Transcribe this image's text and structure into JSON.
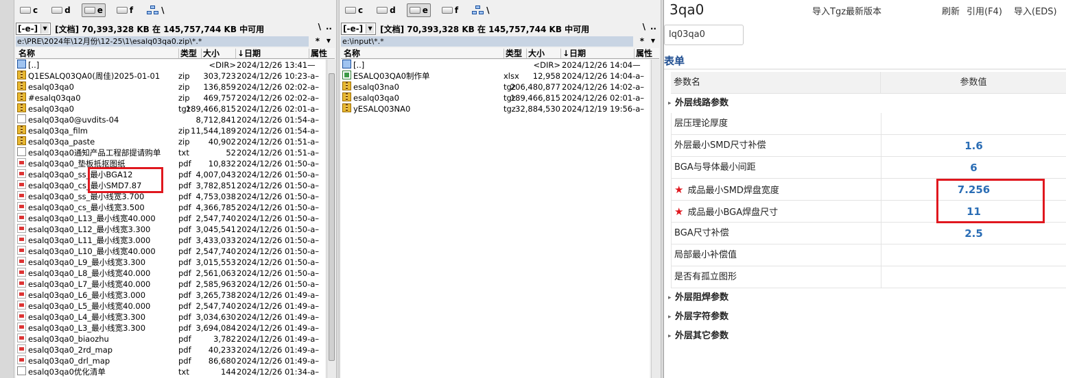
{
  "total_commander": {
    "drives": [
      "c",
      "d",
      "e",
      "f",
      "\\"
    ],
    "active_drive": "e",
    "left": {
      "drive_select": "[-e-]",
      "info": "[文档]  70,393,328 KB 在 145,757,744 KB 中可用",
      "back_btn": "\\",
      "up_btn": "..",
      "path": "e:\\PRE\\2024年\\12月份\\12-25\\1\\esalq03qa0.zip\\*.*",
      "filter_star": "*",
      "columns": [
        "名称",
        "类型",
        "大小",
        "↓日期",
        "属性"
      ],
      "files": [
        {
          "icon": "up",
          "name": "[..]",
          "type": "",
          "size": "<DIR>",
          "date": "2024/12/26 13:41—"
        },
        {
          "icon": "zip",
          "name": "Q1ESALQ03QA0(周佳)2025-01-01",
          "type": "zip",
          "size": "303,723",
          "date": "2024/12/26 10:23-a–"
        },
        {
          "icon": "zip",
          "name": "esalq03qa0",
          "type": "zip",
          "size": "136,859",
          "date": "2024/12/26 02:02-a–"
        },
        {
          "icon": "zip",
          "name": "#esalq03qa0",
          "type": "zip",
          "size": "469,757",
          "date": "2024/12/26 02:02-a–"
        },
        {
          "icon": "zip",
          "name": "esalq03qa0",
          "type": "tgz",
          "size": "189,466,815",
          "date": "2024/12/26 02:01-a–"
        },
        {
          "icon": "doc",
          "name": "esalq03qa0@uvdits-04",
          "type": "",
          "size": "8,712,841",
          "date": "2024/12/26 01:54-a–"
        },
        {
          "icon": "zip",
          "name": "esalq03qa_film",
          "type": "zip",
          "size": "11,544,189",
          "date": "2024/12/26 01:54-a–"
        },
        {
          "icon": "zip",
          "name": "esalq03qa_paste",
          "type": "zip",
          "size": "40,902",
          "date": "2024/12/26 01:51-a–"
        },
        {
          "icon": "doc",
          "name": "esalq03qa0通知产品工程部提请购单",
          "type": "txt",
          "size": "52",
          "date": "2024/12/26 01:51-a–"
        },
        {
          "icon": "pdf",
          "name": "esalq03qa0_垫板抵抠图纸",
          "type": "pdf",
          "size": "10,832",
          "date": "2024/12/26 01:50-a–"
        },
        {
          "icon": "pdf",
          "name": "esalq03qa0_ss_最小BGA12",
          "type": "pdf",
          "size": "4,007,043",
          "date": "2024/12/26 01:50-a–"
        },
        {
          "icon": "pdf",
          "name": "esalq03qa0_cs_最小SMD7.87",
          "type": "pdf",
          "size": "3,782,851",
          "date": "2024/12/26 01:50-a–"
        },
        {
          "icon": "pdf",
          "name": "esalq03qa0_ss_最小线宽3.700",
          "type": "pdf",
          "size": "4,753,038",
          "date": "2024/12/26 01:50-a–"
        },
        {
          "icon": "pdf",
          "name": "esalq03qa0_cs_最小线宽3.500",
          "type": "pdf",
          "size": "4,366,785",
          "date": "2024/12/26 01:50-a–"
        },
        {
          "icon": "pdf",
          "name": "esalq03qa0_L13_最小线宽40.000",
          "type": "pdf",
          "size": "2,547,740",
          "date": "2024/12/26 01:50-a–"
        },
        {
          "icon": "pdf",
          "name": "esalq03qa0_L12_最小线宽3.300",
          "type": "pdf",
          "size": "3,045,541",
          "date": "2024/12/26 01:50-a–"
        },
        {
          "icon": "pdf",
          "name": "esalq03qa0_L11_最小线宽3.000",
          "type": "pdf",
          "size": "3,433,033",
          "date": "2024/12/26 01:50-a–"
        },
        {
          "icon": "pdf",
          "name": "esalq03qa0_L10_最小线宽40.000",
          "type": "pdf",
          "size": "2,547,740",
          "date": "2024/12/26 01:50-a–"
        },
        {
          "icon": "pdf",
          "name": "esalq03qa0_L9_最小线宽3.300",
          "type": "pdf",
          "size": "3,015,553",
          "date": "2024/12/26 01:50-a–"
        },
        {
          "icon": "pdf",
          "name": "esalq03qa0_L8_最小线宽40.000",
          "type": "pdf",
          "size": "2,561,063",
          "date": "2024/12/26 01:50-a–"
        },
        {
          "icon": "pdf",
          "name": "esalq03qa0_L7_最小线宽40.000",
          "type": "pdf",
          "size": "2,585,963",
          "date": "2024/12/26 01:50-a–"
        },
        {
          "icon": "pdf",
          "name": "esalq03qa0_L6_最小线宽3.000",
          "type": "pdf",
          "size": "3,265,738",
          "date": "2024/12/26 01:49-a–"
        },
        {
          "icon": "pdf",
          "name": "esalq03qa0_L5_最小线宽40.000",
          "type": "pdf",
          "size": "2,547,740",
          "date": "2024/12/26 01:49-a–"
        },
        {
          "icon": "pdf",
          "name": "esalq03qa0_L4_最小线宽3.300",
          "type": "pdf",
          "size": "3,034,630",
          "date": "2024/12/26 01:49-a–"
        },
        {
          "icon": "pdf",
          "name": "esalq03qa0_L3_最小线宽3.300",
          "type": "pdf",
          "size": "3,694,084",
          "date": "2024/12/26 01:49-a–"
        },
        {
          "icon": "pdf",
          "name": "esalq03qa0_biaozhu",
          "type": "pdf",
          "size": "3,782",
          "date": "2024/12/26 01:49-a–"
        },
        {
          "icon": "pdf",
          "name": "esalq03qa0_2rd_map",
          "type": "pdf",
          "size": "40,233",
          "date": "2024/12/26 01:49-a–"
        },
        {
          "icon": "pdf",
          "name": "esalq03qa0_drl_map",
          "type": "pdf",
          "size": "86,680",
          "date": "2024/12/26 01:49-a–"
        },
        {
          "icon": "doc",
          "name": "esalq03qa0优化清单",
          "type": "txt",
          "size": "144",
          "date": "2024/12/26 01:34-a–"
        }
      ]
    },
    "right": {
      "drive_select": "[-e-]",
      "info": "[文档]  70,393,328 KB 在 145,757,744 KB 中可用",
      "back_btn": "\\",
      "up_btn": "..",
      "path": "e:\\input\\*.*",
      "filter_star": "*",
      "columns": [
        "名称",
        "类型",
        "大小",
        "↓日期",
        "属性"
      ],
      "files": [
        {
          "icon": "up",
          "name": "[..]",
          "type": "",
          "size": "<DIR>",
          "date": "2024/12/26 14:04—"
        },
        {
          "icon": "xls",
          "name": "ESALQ03QA0制作单",
          "type": "xlsx",
          "size": "12,958",
          "date": "2024/12/26 14:04-a–"
        },
        {
          "icon": "zip",
          "name": "esalq03na0",
          "type": "tgz",
          "size": "206,480,877",
          "date": "2024/12/26 14:02-a–"
        },
        {
          "icon": "zip",
          "name": "esalq03qa0",
          "type": "tgz",
          "size": "189,466,815",
          "date": "2024/12/26 02:01-a–"
        },
        {
          "icon": "zip",
          "name": "yESALQ03NA0",
          "type": "tgz",
          "size": "32,884,530",
          "date": "2024/12/19 19:56-a–"
        }
      ]
    }
  },
  "app": {
    "title": "3qa0",
    "menu": {
      "import_tgz": "导入Tgz最新版本",
      "refresh": "刷新",
      "quote": "引用(F4)",
      "import_eds": "导入(EDS)"
    },
    "search_value": "lq03qa0",
    "form_title": "表单",
    "header": {
      "name": "参数名",
      "value": "参数值"
    },
    "sections": {
      "outer_line": "外层线路参数",
      "solder_mask": "外层阻焊参数",
      "legend": "外层字符参数",
      "other": "外层其它参数"
    },
    "params": [
      {
        "name": "层压理论厚度",
        "value": "",
        "required": false
      },
      {
        "name": "外层最小SMD尺寸补偿",
        "value": "1.6",
        "required": false
      },
      {
        "name": "BGA与导体最小间距",
        "value": "6",
        "required": false
      },
      {
        "name": "成品最小SMD焊盘宽度",
        "value": "7.256",
        "required": true
      },
      {
        "name": "成品最小BGA焊盘尺寸",
        "value": "11",
        "required": true
      },
      {
        "name": "BGA尺寸补偿",
        "value": "2.5",
        "required": false
      },
      {
        "name": "局部最小补偿值",
        "value": "",
        "required": false
      },
      {
        "name": "是否有孤立图形",
        "value": "",
        "required": false
      }
    ],
    "required_mark": "★"
  }
}
